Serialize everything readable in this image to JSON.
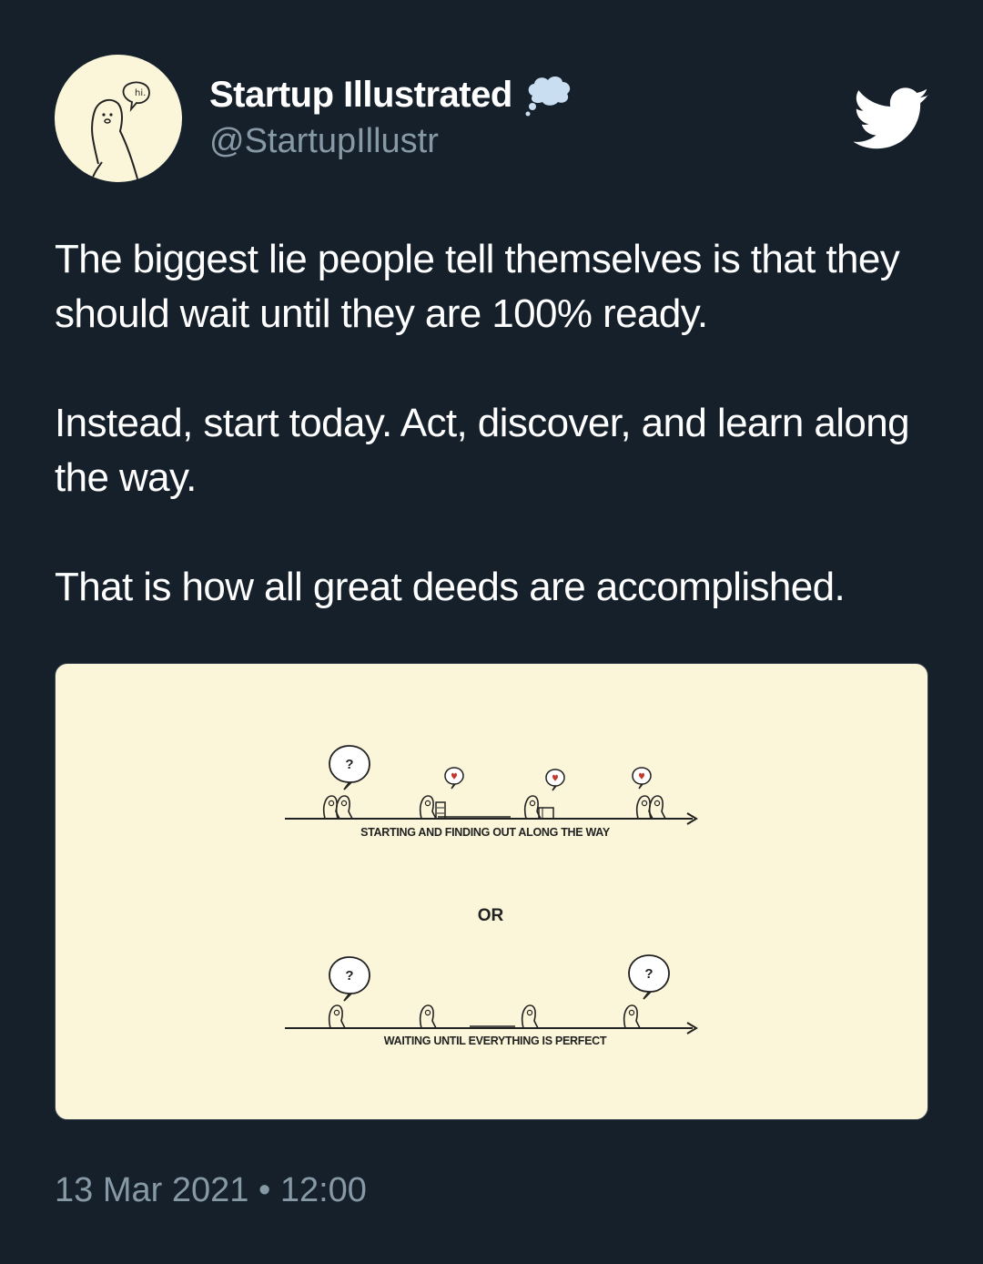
{
  "author": {
    "name": "Startup Illustrated",
    "handle": "@StartupIllustr",
    "avatar_speech": "hi.",
    "avatar_icon": "duck-avatar-icon",
    "badge_icon": "thought-bubble-icon"
  },
  "platform_icon": "twitter-bird-icon",
  "tweet": {
    "paragraphs": [
      "The biggest lie people tell themselves is that they should wait until they are 100% ready.",
      "Instead, start today. Act, discover, and learn along the way.",
      "That is how all great deeds are accomplished."
    ]
  },
  "illustration": {
    "top_caption": "STARTING AND FINDING OUT ALONG THE WAY",
    "middle_label": "OR",
    "bottom_caption": "WAITING UNTIL EVERYTHING IS PERFECT",
    "question_mark": "?"
  },
  "meta": {
    "date": "13 Mar 2021",
    "separator": "•",
    "time": "12:00"
  },
  "colors": {
    "background": "#15202b",
    "text_primary": "#ffffff",
    "text_secondary": "#8899a6",
    "illustration_bg": "#fbf6d9",
    "badge": "#c9def0",
    "heart": "#c0392b"
  }
}
